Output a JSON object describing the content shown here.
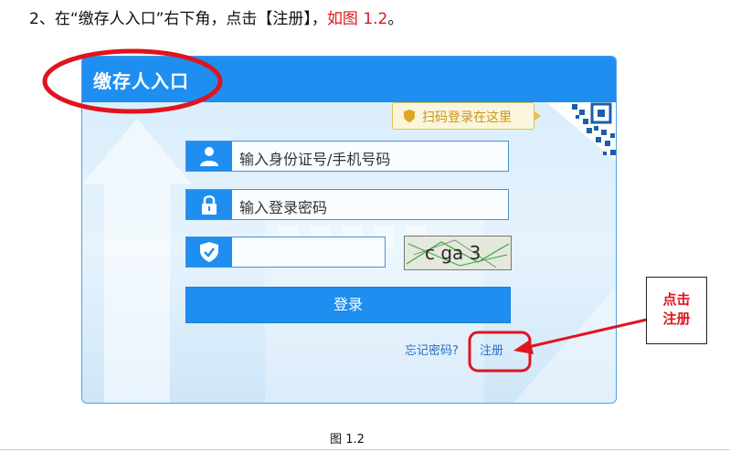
{
  "instruction": {
    "prefix": "2、在“缴存人入口”右下角，点击【注册】，",
    "highlight": "如图 1.2",
    "suffix": "。"
  },
  "panel": {
    "title": "缴存人入口",
    "qr_tip": "扫码登录在这里",
    "username_placeholder": "输入身份证号/手机号码",
    "password_placeholder": "输入登录密码",
    "captcha_value": "",
    "captcha_text": "c ga 3",
    "login_label": "登录",
    "forgot_label": "忘记密码?",
    "register_label": "注册"
  },
  "annotation": {
    "callout_line1": "点击",
    "callout_line2": "注册"
  },
  "caption": "图 1.2",
  "colors": {
    "primary": "#1e8ff0",
    "annotation_red": "#e0141e",
    "link": "#2a6fbf",
    "tip_text": "#c8961e"
  }
}
